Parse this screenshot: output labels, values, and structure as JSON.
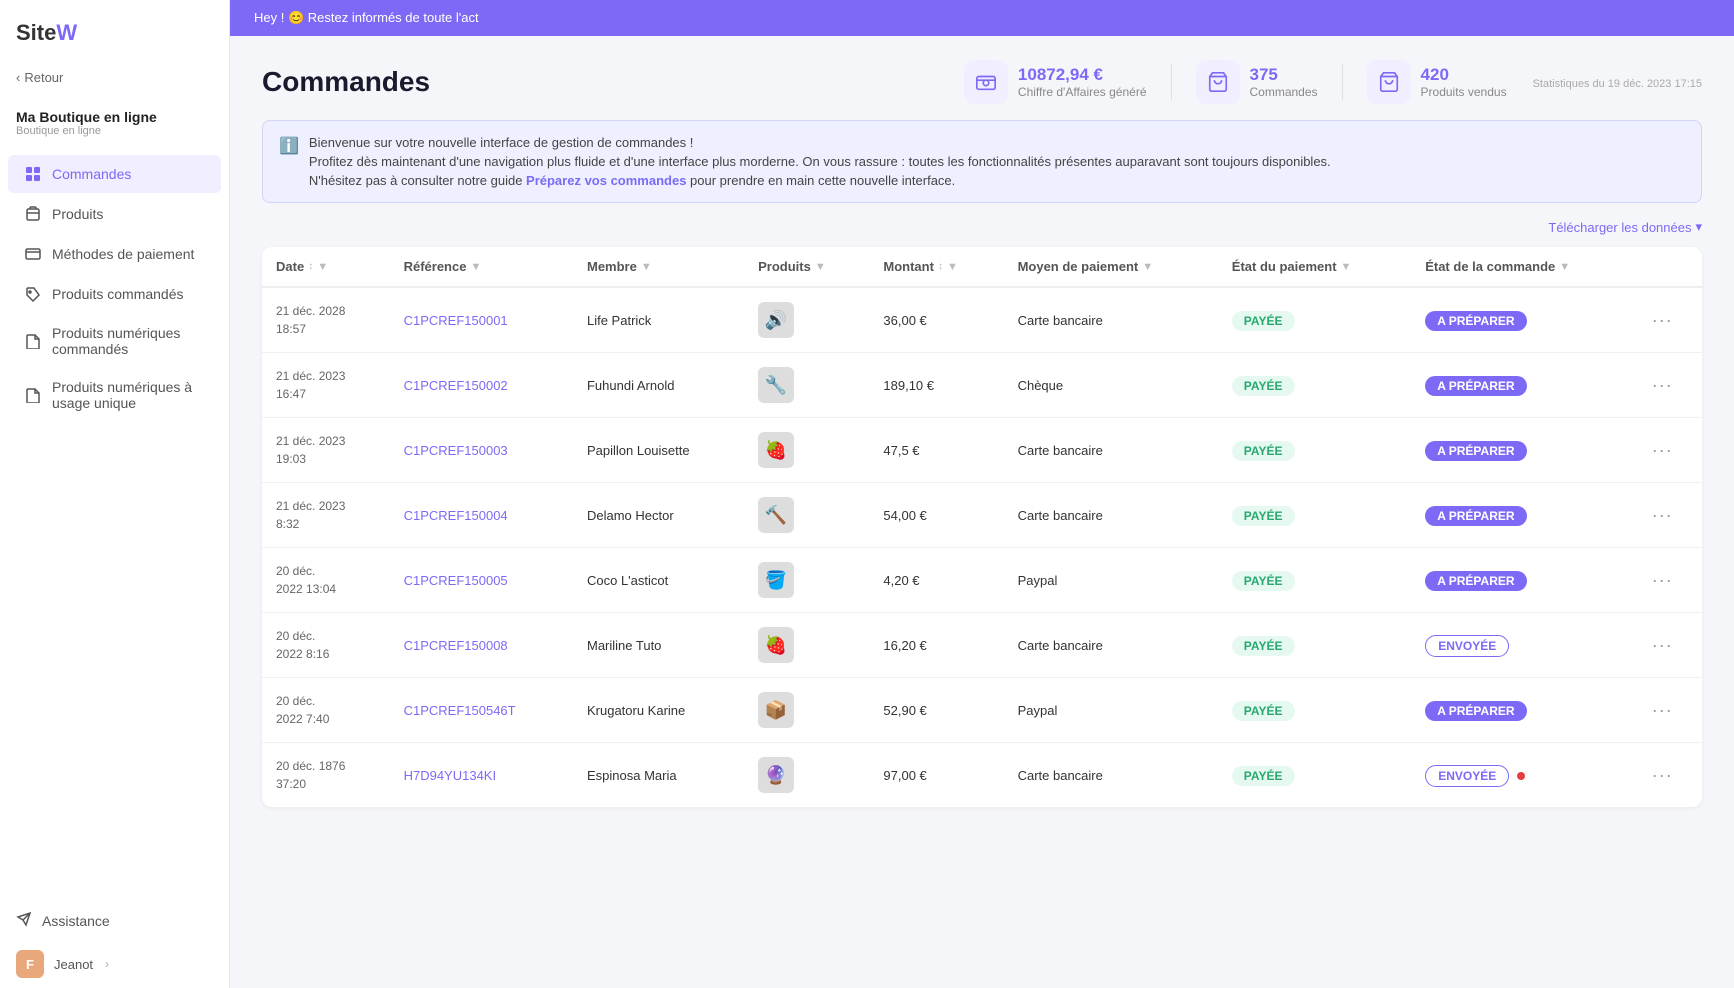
{
  "sidebar": {
    "logo": "SiteW",
    "back_label": "Retour",
    "shop_name": "Ma Boutique en ligne",
    "shop_sub": "Boutique en ligne",
    "nav_items": [
      {
        "id": "commandes",
        "label": "Commandes",
        "icon": "grid",
        "active": true
      },
      {
        "id": "produits",
        "label": "Produits",
        "icon": "box",
        "active": false
      },
      {
        "id": "paiements",
        "label": "Méthodes de paiement",
        "icon": "card",
        "active": false
      },
      {
        "id": "produits-commandes",
        "label": "Produits commandés",
        "icon": "tag",
        "active": false
      },
      {
        "id": "produits-numeriques",
        "label": "Produits numériques commandés",
        "icon": "file",
        "active": false
      },
      {
        "id": "produits-numeriques-unique",
        "label": "Produits numériques à usage unique",
        "icon": "file2",
        "active": false
      }
    ],
    "assistance_label": "Assistance",
    "user_name": "Jeanot",
    "user_initials": "F"
  },
  "top_banner": {
    "text": "Hey ! 😊 Restez informés de toute l'act"
  },
  "header": {
    "title": "Commandes",
    "stats": [
      {
        "value": "10872,94 €",
        "label": "Chiffre d'Affaires généré",
        "icon": "cash"
      },
      {
        "value": "375",
        "label": "Commandes",
        "icon": "cart"
      },
      {
        "value": "420",
        "label": "Produits vendus",
        "icon": "bag"
      }
    ],
    "stats_date": "Statistiques du 19 déc. 2023 17:15"
  },
  "info_box": {
    "line1": "Bienvenue sur votre nouvelle interface de gestion de commandes !",
    "line2": "Profitez dès maintenant d'une navigation plus fluide et d'une interface plus morderne. On vous rassure : toutes les fonctionnalités présentes auparavant sont toujours disponibles.",
    "line3_pre": "N'hésitez pas à consulter notre guide ",
    "line3_link": "Préparez vos commandes",
    "line3_post": " pour prendre en main cette nouvelle interface."
  },
  "table": {
    "download_label": "Télécharger les données",
    "columns": [
      "Date",
      "Référence",
      "Membre",
      "Produits",
      "Montant",
      "Moyen de paiement",
      "État du paiement",
      "État de la commande"
    ],
    "rows": [
      {
        "date": "21 déc. 2028\n18:57",
        "reference": "C1PCREF150001",
        "membre": "Life Patrick",
        "produit_emoji": "🔊",
        "montant": "36,00 €",
        "paiement": "Carte bancaire",
        "etat_paiement": "PAYÉE",
        "etat_commande": "A PRÉPARER",
        "etat_commande_type": "prepare",
        "has_dot": false
      },
      {
        "date": "21 déc. 2023\n16:47",
        "reference": "C1PCREF150002",
        "membre": "Fuhundi Arnold",
        "produit_emoji": "🔧",
        "montant": "189,10 €",
        "paiement": "Chèque",
        "etat_paiement": "PAYÉE",
        "etat_commande": "A PRÉPARER",
        "etat_commande_type": "prepare",
        "has_dot": false
      },
      {
        "date": "21 déc. 2023\n19:03",
        "reference": "C1PCREF150003",
        "membre": "Papillon Louisette",
        "produit_emoji": "🍓",
        "montant": "47,5 €",
        "paiement": "Carte bancaire",
        "etat_paiement": "PAYÉE",
        "etat_commande": "A PRÉPARER",
        "etat_commande_type": "prepare",
        "has_dot": false
      },
      {
        "date": "21 déc. 2023\n8:32",
        "reference": "C1PCREF150004",
        "membre": "Delamo Hector",
        "produit_emoji": "🔨",
        "montant": "54,00 €",
        "paiement": "Carte bancaire",
        "etat_paiement": "PAYÉE",
        "etat_commande": "A PRÉPARER",
        "etat_commande_type": "prepare",
        "has_dot": false
      },
      {
        "date": "20 déc.\n2022 13:04",
        "reference": "C1PCREF150005",
        "membre": "Coco L'asticot",
        "produit_emoji": "🪣",
        "montant": "4,20 €",
        "paiement": "Paypal",
        "etat_paiement": "PAYÉE",
        "etat_commande": "A PRÉPARER",
        "etat_commande_type": "prepare",
        "has_dot": false
      },
      {
        "date": "20 déc.\n2022 8:16",
        "reference": "C1PCREF150008",
        "membre": "Mariline Tuto",
        "produit_emoji": "🍓",
        "montant": "16,20 €",
        "paiement": "Carte bancaire",
        "etat_paiement": "PAYÉE",
        "etat_commande": "ENVOYÉE",
        "etat_commande_type": "sent",
        "has_dot": false
      },
      {
        "date": "20 déc.\n2022 7:40",
        "reference": "C1PCREF150546T",
        "membre": "Krugatoru Karine",
        "produit_emoji": "📦",
        "montant": "52,90 €",
        "paiement": "Paypal",
        "etat_paiement": "PAYÉE",
        "etat_commande": "A PRÉPARER",
        "etat_commande_type": "prepare",
        "has_dot": false
      },
      {
        "date": "20 déc. 1876\n37:20",
        "reference": "H7D94YU134KI",
        "membre": "Espinosa Maria",
        "produit_emoji": "🔮",
        "montant": "97,00 €",
        "paiement": "Carte bancaire",
        "etat_paiement": "PAYÉE",
        "etat_commande": "ENVOYÉE",
        "etat_commande_type": "sent",
        "has_dot": true
      }
    ]
  }
}
